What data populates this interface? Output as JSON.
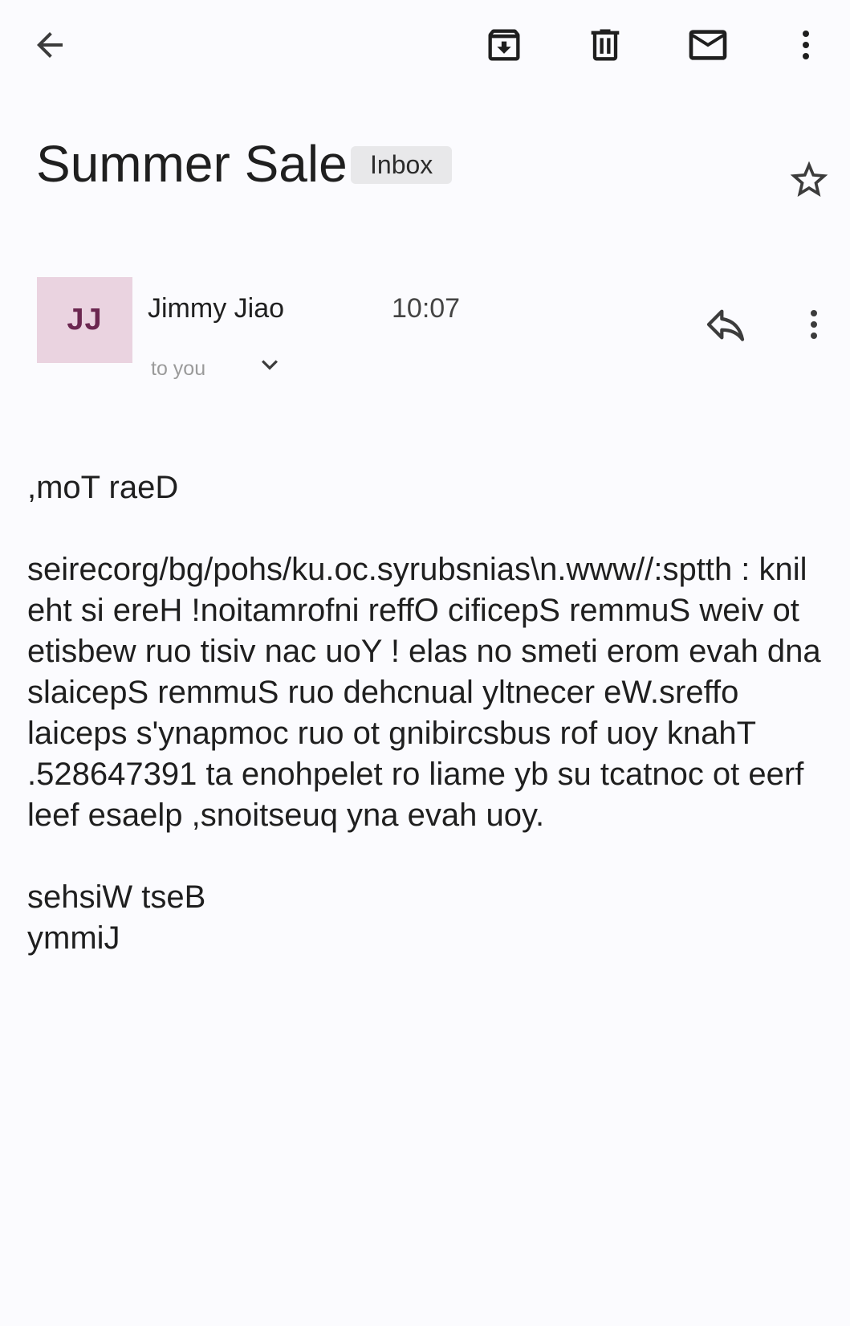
{
  "toolbar": {
    "icons": [
      "back-arrow-icon",
      "archive-icon",
      "trash-icon",
      "mail-icon",
      "more-vert-icon"
    ]
  },
  "email": {
    "subject": "Summer Sale",
    "label": "Inbox",
    "sender": {
      "name": "Jimmy Jiao",
      "initials": "JJ"
    },
    "time": "10:07",
    "recipients": "to you",
    "body": {
      "greeting": ",moT raeD",
      "paragraph": "seirecorg/bg/pohs/ku.oc.syrubsnias\\n.www//:sptth : knil eht si ereH !noitamrofni reffO cificepS remmuS weiv ot etisbew ruo tisiv nac uoY ! elas no smeti erom evah dna slaicepS remmuS ruo dehcnual yltnecer eW.sreffo laiceps s'ynapmoc ruo ot gnibircsbus rof uoy knahT .528647391 ta enohpelet ro liame yb su tcatnoc ot eerf leef esaelp ,snoitseuq yna evah uoy.",
      "closing": "sehsiW tseB",
      "signature": "ymmiJ"
    }
  },
  "colors": {
    "background": "#fbfbfe",
    "avatar_bg": "#ead3e0",
    "avatar_text": "#6b2750",
    "chip_bg": "#e8e8ea",
    "icon": "#3c3c3c"
  }
}
